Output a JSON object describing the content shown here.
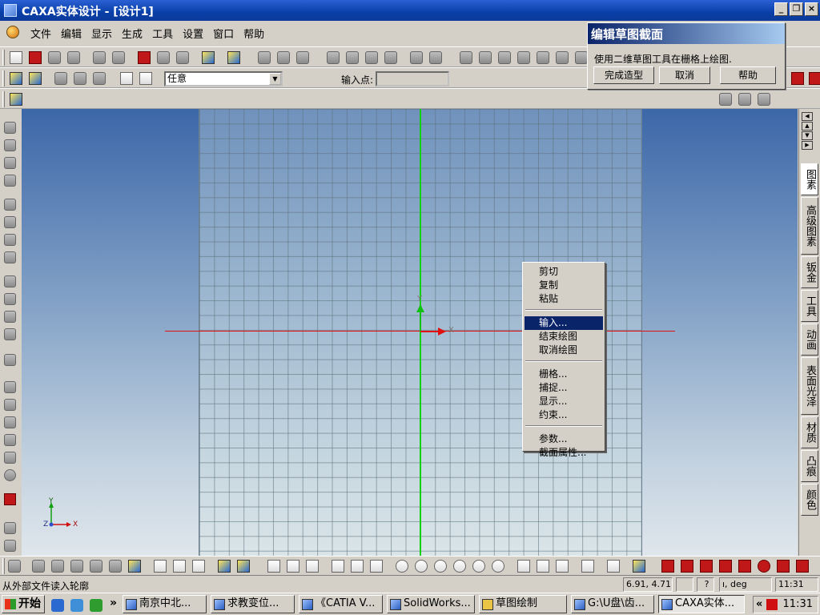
{
  "window": {
    "title": "CAXA实体设计 - [设计1]",
    "buttons": [
      "_",
      "❐",
      "×"
    ]
  },
  "menu": {
    "items": [
      "文件",
      "编辑",
      "显示",
      "生成",
      "工具",
      "设置",
      "窗口",
      "帮助"
    ]
  },
  "toolbar2": {
    "select_mode": "任意",
    "input_point_label": "输入点:",
    "input_point_value": ""
  },
  "dialog": {
    "title": "编辑草图截面",
    "message": "使用二维草图工具在栅格上绘图.",
    "buttons": {
      "finish": "完成造型",
      "cancel": "取消",
      "help": "帮助"
    }
  },
  "viewport": {
    "x_label": "X",
    "y_label": "Y",
    "mini_x": "X",
    "mini_y": "Y",
    "mini_z": "Z"
  },
  "context_menu": {
    "items": [
      "剪切",
      "复制",
      "粘贴",
      "输入...",
      "结束绘图",
      "取消绘图",
      "栅格...",
      "捕捉...",
      "显示...",
      "约束...",
      "参数...",
      "截面属性..."
    ],
    "selected": "输入..."
  },
  "right_tabs": [
    "图素",
    "高级图素",
    "钣金",
    "工具",
    "动画",
    "表面光泽",
    "材质",
    "凸痕",
    "颜色"
  ],
  "status": {
    "text": "从外部文件读入轮廓",
    "coords": "6.91, 4.71",
    "units": "ı, deg",
    "time": "11:31"
  },
  "taskbar": {
    "start": "开始",
    "tasks": [
      "南京中北...",
      "求教变位...",
      "《CATIA V...",
      "SolidWorks...",
      "草图绘制",
      "G:\\U盘\\齿...",
      "CAXA实体..."
    ],
    "clock": "11:31"
  },
  "colors": {
    "x_axis": "#e01010",
    "y_axis": "#10d010",
    "selection": "#0a246a"
  }
}
